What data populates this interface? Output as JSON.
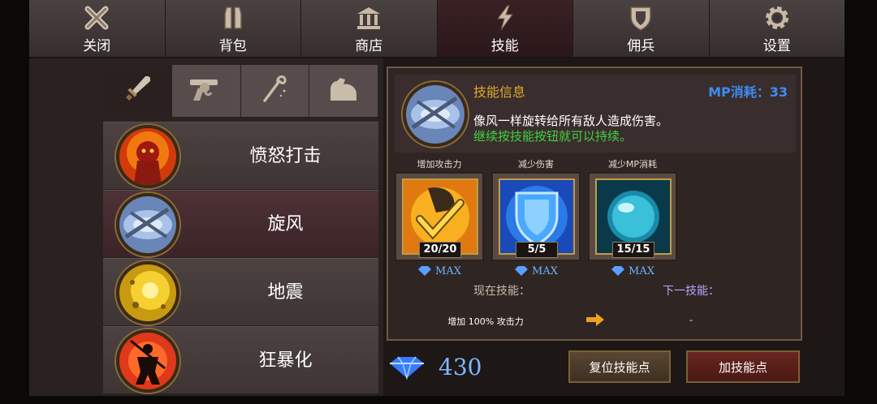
{
  "top_tabs": [
    {
      "label": "关闭",
      "icon": "close-icon"
    },
    {
      "label": "背包",
      "icon": "backpack-icon"
    },
    {
      "label": "商店",
      "icon": "shop-icon"
    },
    {
      "label": "技能",
      "icon": "skill-icon"
    },
    {
      "label": "佣兵",
      "icon": "mercenary-shield-icon"
    },
    {
      "label": "设置",
      "icon": "gear-icon"
    }
  ],
  "active_tab": "技能",
  "categories": [
    {
      "icon": "sword-icon"
    },
    {
      "icon": "revolver-icon"
    },
    {
      "icon": "staff-icon"
    },
    {
      "icon": "muscle-arm-icon"
    }
  ],
  "skills": [
    {
      "name": "愤怒打击",
      "icon": "rage-strike-icon"
    },
    {
      "name": "旋风",
      "icon": "whirlwind-icon"
    },
    {
      "name": "地震",
      "icon": "earthquake-icon"
    },
    {
      "name": "狂暴化",
      "icon": "berserk-icon"
    }
  ],
  "selected_skill": "旋风",
  "info": {
    "title": "技能信息",
    "mp_cost": "MP消耗：33",
    "desc_line1": "像风一样旋转给所有敌人造成伤害。",
    "desc_line2": "继续按技能按钮就可以持续。"
  },
  "upgrades": [
    {
      "label": "增加攻击力",
      "count": "20/20",
      "max": "MAX",
      "icon": "attack-boost-icon"
    },
    {
      "label": "减少伤害",
      "count": "5/5",
      "max": "MAX",
      "icon": "shield-defense-icon"
    },
    {
      "label": "减少MP消耗",
      "count": "15/15",
      "max": "MAX",
      "icon": "mp-orb-icon"
    }
  ],
  "current_skill_label": "现在技能：",
  "next_skill_label": "下一技能：",
  "current_skill_value": "增加 100% 攻击力",
  "next_skill_value": "-",
  "gems": "430",
  "buttons": {
    "reset": "复位技能点",
    "add": "加技能点"
  },
  "colors": {
    "accent_gold": "#e0aa2a",
    "mp_blue": "#3d8cf2",
    "desc_green": "#3fd43f"
  }
}
